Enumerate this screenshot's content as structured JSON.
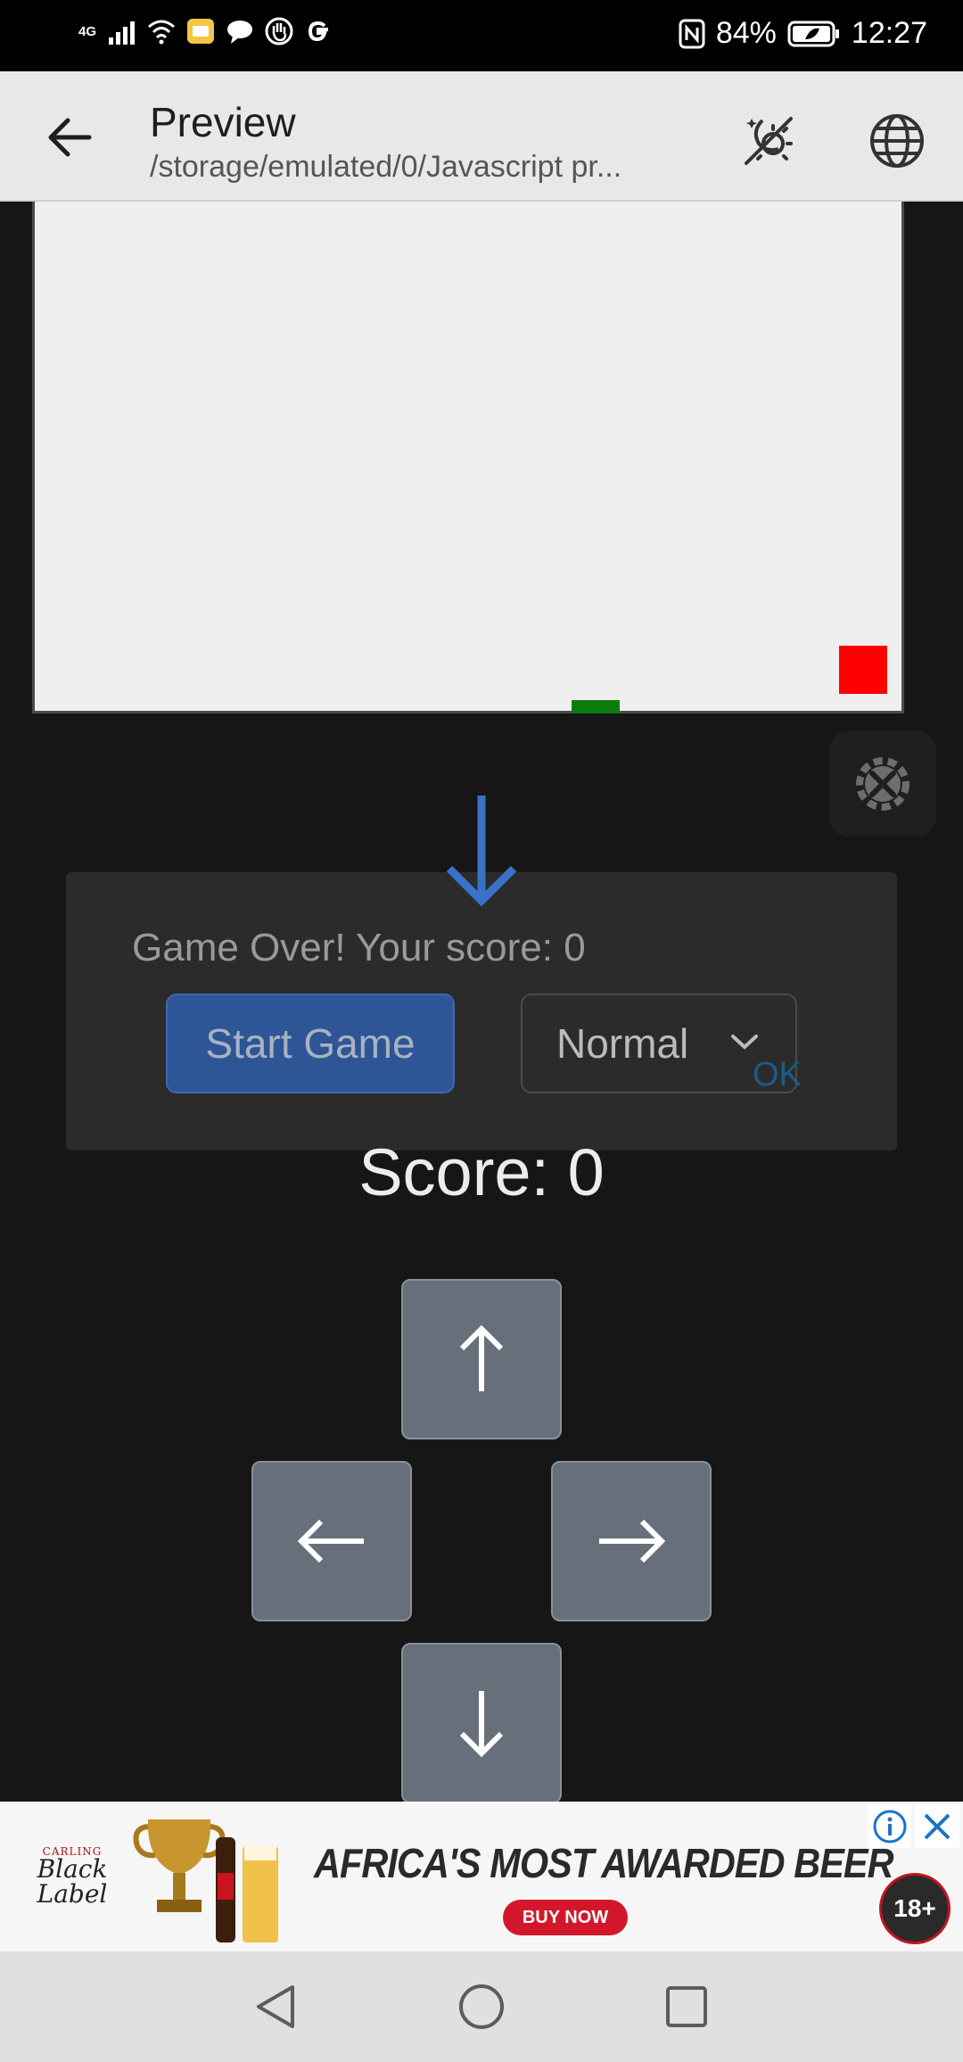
{
  "status_bar": {
    "network": "4G",
    "battery": "84%",
    "time": "12:27"
  },
  "app_bar": {
    "title": "Preview",
    "subtitle": "/storage/emulated/0/Javascript pr..."
  },
  "dialog": {
    "message": "Game Over! Your score: 0",
    "start_button": "Start Game",
    "difficulty": "Normal",
    "ok_label": "OK"
  },
  "score": "Score: 0",
  "controls": {
    "up": "↑",
    "left": "←",
    "right": "→",
    "down": "↓"
  },
  "ad": {
    "brand_name": "Black Label",
    "brand_small": "CARLING",
    "headline": "AFRICA'S MOST AWARDED BEER",
    "cta": "BUY NOW",
    "age_badge": "18+"
  },
  "colors": {
    "food": "#ff0000",
    "snake": "#0c7d0c",
    "accent_blue": "#3a72c8",
    "board": "#efefef"
  },
  "icons": {
    "back": "arrow-left-icon",
    "theme": "theme-toggle-icon",
    "globe": "globe-icon",
    "settings": "gear-tools-icon",
    "ad_info": "info-icon",
    "ad_close": "close-icon"
  }
}
